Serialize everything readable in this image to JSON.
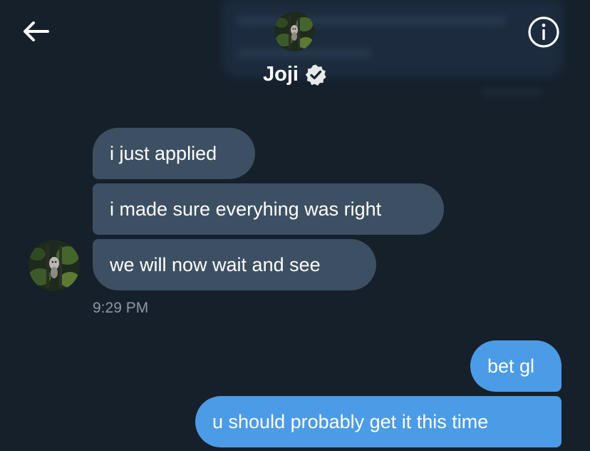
{
  "header": {
    "name": "Joji",
    "verified": true,
    "back_icon": "arrow-left-icon",
    "info_icon": "info-circle-icon",
    "verified_icon": "verified-badge-icon"
  },
  "conversation": {
    "incoming": [
      "i just applied",
      "i made sure everyhing was right",
      "we will now wait and see"
    ],
    "incoming_time": "9:29 PM",
    "outgoing": [
      "bet gl",
      "u should probably get it this time"
    ]
  },
  "colors": {
    "background": "#15202b",
    "incoming_bubble": "#3d4f62",
    "outgoing_bubble": "#4c9be6",
    "timestamp": "#8b98a5"
  }
}
